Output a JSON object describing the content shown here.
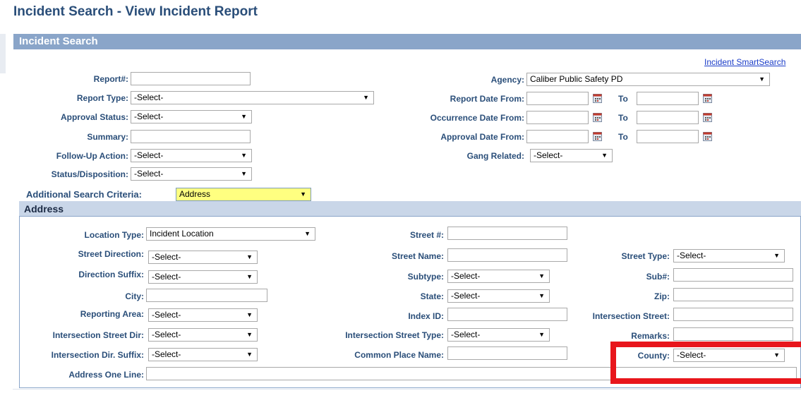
{
  "page_title": "Incident Search - View Incident Report",
  "panel_title": "Incident Search",
  "smart_search_link": "Incident SmartSearch",
  "search": {
    "report_no_label": "Report#:",
    "report_type_label": "Report Type:",
    "report_type_value": "-Select-",
    "approval_status_label": "Approval Status:",
    "approval_status_value": "-Select-",
    "summary_label": "Summary:",
    "follow_up_label": "Follow-Up Action:",
    "follow_up_value": "-Select-",
    "status_disposition_label": "Status/Disposition:",
    "status_disposition_value": "-Select-",
    "agency_label": "Agency:",
    "agency_value": "Caliber Public Safety PD",
    "report_date_from_label": "Report Date From:",
    "occurrence_date_from_label": "Occurrence Date From:",
    "approval_date_from_label": "Approval Date From:",
    "to_label": "To",
    "gang_related_label": "Gang Related:",
    "gang_related_value": "-Select-"
  },
  "additional": {
    "label": "Additional Search Criteria:",
    "value": "Address"
  },
  "address": {
    "header": "Address",
    "location_type_label": "Location Type:",
    "location_type_value": "Incident Location",
    "street_direction_label": "Street Direction:",
    "street_direction_value": "-Select-",
    "direction_suffix_label": "Direction Suffix:",
    "direction_suffix_value": "-Select-",
    "city_label": "City:",
    "reporting_area_label": "Reporting Area:",
    "reporting_area_value": "-Select-",
    "intersection_street_dir_label": "Intersection Street Dir:",
    "intersection_street_dir_value": "-Select-",
    "intersection_dir_suffix_label": "Intersection Dir. Suffix:",
    "intersection_dir_suffix_value": "-Select-",
    "address_one_line_label": "Address One Line:",
    "street_no_label": "Street #:",
    "street_name_label": "Street Name:",
    "subtype_label": "Subtype:",
    "subtype_value": "-Select-",
    "state_label": "State:",
    "state_value": "-Select-",
    "index_id_label": "Index ID:",
    "intersection_street_type_label": "Intersection Street Type:",
    "intersection_street_type_value": "-Select-",
    "common_place_name_label": "Common Place Name:",
    "street_type_label": "Street Type:",
    "street_type_value": "-Select-",
    "sub_no_label": "Sub#:",
    "zip_label": "Zip:",
    "intersection_street_label": "Intersection Street:",
    "remarks_label": "Remarks:",
    "county_label": "County:",
    "county_value": "-Select-"
  },
  "colors": {
    "header_blue": "#8aa5c9",
    "label_blue": "#2a4e79",
    "highlight_yellow": "#ffff80",
    "annotation_red": "#e8161c"
  },
  "icons": {
    "calendar": "calendar-icon",
    "dropdown": "chevron-down-icon"
  }
}
